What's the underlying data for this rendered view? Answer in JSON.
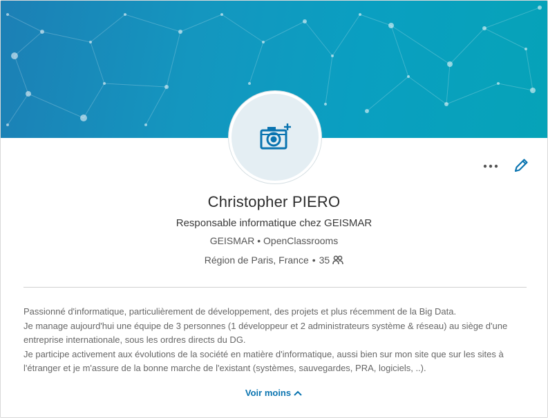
{
  "profile": {
    "name": "Christopher PIERO",
    "headline": "Responsable informatique chez GEISMAR",
    "current_company": "GEISMAR",
    "education": "OpenClassrooms",
    "separator": "•",
    "location": "Région de Paris, France",
    "connections": "35"
  },
  "summary": {
    "lines": [
      "Passionné d'informatique, particulièrement de développement, des projets et plus récemment de la Big Data.",
      "Je manage aujourd'hui une équipe de 3 personnes (1 développeur et 2 administrateurs système & réseau) au siège d'une entreprise internationale, sous les ordres directs du DG.",
      "Je participe activement aux évolutions de la société en matière d'informatique, aussi bien sur mon site que sur les sites à l'étranger et je m'assure de la bonne marche de l'existant (systèmes, sauvegardes, PRA, logiciels, ..)."
    ],
    "toggle_label": "Voir moins"
  },
  "icons": {
    "avatar": "camera-plus-icon",
    "more": "more-dots-icon",
    "edit": "pencil-icon",
    "connections": "people-icon",
    "toggle": "chevron-up-icon"
  },
  "colors": {
    "accent": "#0a74b0",
    "banner_start": "#1c7fb5",
    "banner_end": "#06a3b8"
  }
}
